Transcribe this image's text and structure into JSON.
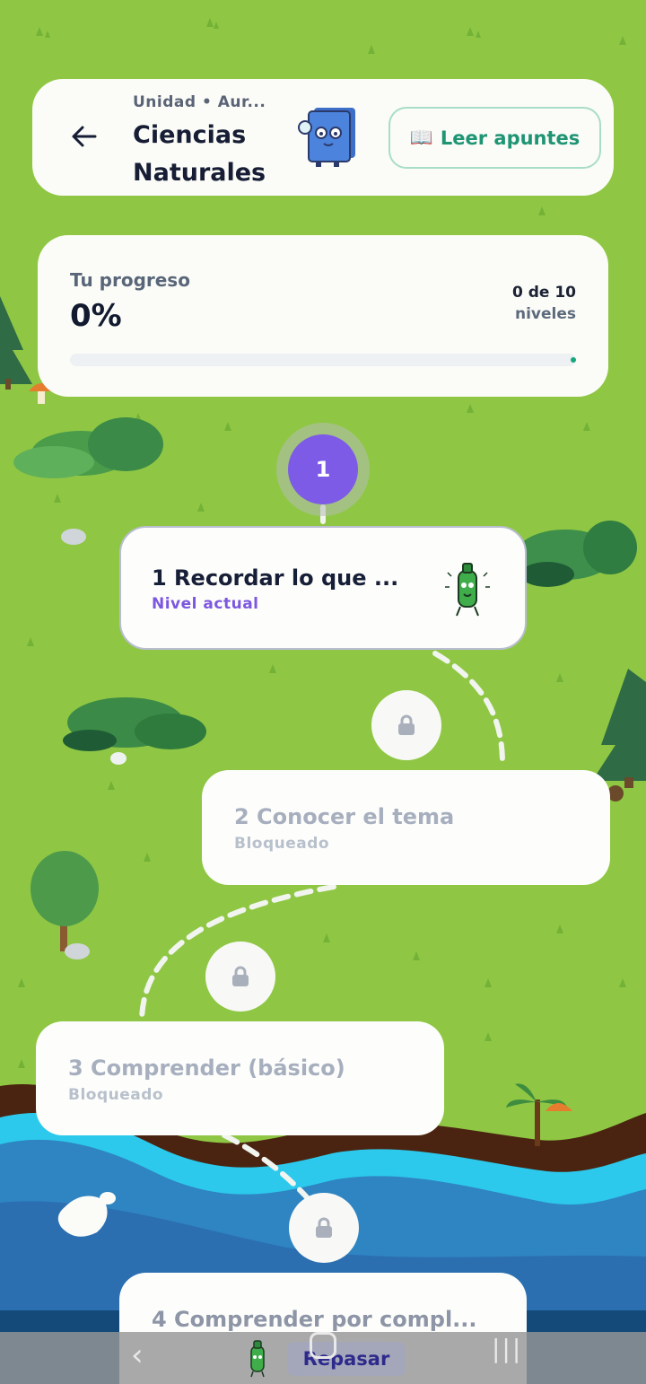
{
  "header": {
    "breadcrumb": "Unidad • Aur...",
    "title": "Ciencias Naturales",
    "notes_icon": "📖",
    "notes_label": "Leer apuntes"
  },
  "progress": {
    "label": "Tu progreso",
    "percent_text": "0%",
    "count_text": "0 de 10",
    "count_unit": "niveles",
    "fraction": 0.0
  },
  "levels": [
    {
      "number": "1",
      "title": "1 Recordar lo que ...",
      "status": "Nivel actual",
      "state": "current"
    },
    {
      "number": "2",
      "title": "2 Conocer el tema",
      "status": "Bloqueado",
      "state": "locked"
    },
    {
      "number": "3",
      "title": "3 Comprender (básico)",
      "status": "Bloqueado",
      "state": "locked"
    },
    {
      "number": "4",
      "title": "4 Comprender por compl...",
      "status": "",
      "state": "locked"
    }
  ],
  "bottom": {
    "review_label": "Repasar"
  },
  "colors": {
    "grass": "#8fc744",
    "accent_purple": "#7d5be6",
    "accent_green": "#1f9574",
    "river_light": "#27c9ea",
    "river_dark": "#2e86c3"
  }
}
